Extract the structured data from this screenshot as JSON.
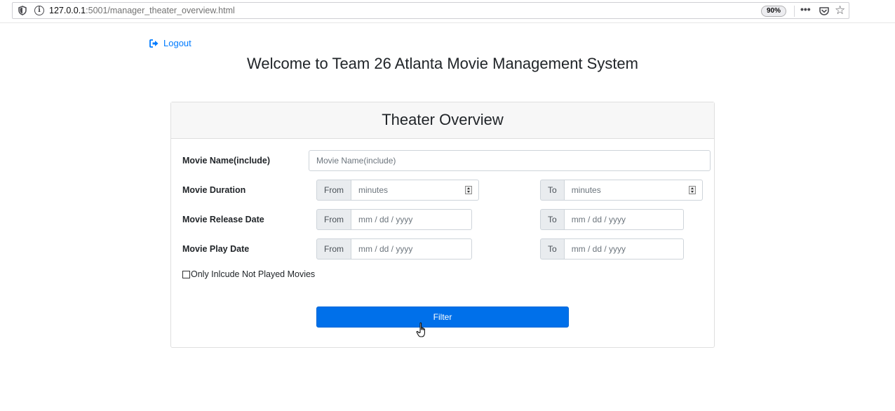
{
  "browser": {
    "url_host": "127.0.0.1",
    "url_rest": ":5001/manager_theater_overview.html",
    "zoom": "90%",
    "more_label": "•••"
  },
  "page": {
    "logout_label": "Logout",
    "title": "Welcome to Team 26 Atlanta Movie Management System"
  },
  "card": {
    "header": "Theater Overview",
    "movie_name": {
      "label": "Movie Name(include)",
      "placeholder": "Movie Name(include)"
    },
    "duration": {
      "label": "Movie Duration",
      "from_label": "From",
      "from_placeholder": "minutes",
      "to_label": "To",
      "to_placeholder": "minutes"
    },
    "release_date": {
      "label": "Movie Release Date",
      "from_label": "From",
      "from_placeholder": "mm / dd / yyyy",
      "to_label": "To",
      "to_placeholder": "mm / dd / yyyy"
    },
    "play_date": {
      "label": "Movie Play Date",
      "from_label": "From",
      "from_placeholder": "mm / dd / yyyy",
      "to_label": "To",
      "to_placeholder": "mm / dd / yyyy"
    },
    "not_played_label": "Only Inlcude Not Played Movies",
    "filter_label": "Filter"
  },
  "colors": {
    "primary": "#007bff",
    "button": "#0070ea"
  }
}
